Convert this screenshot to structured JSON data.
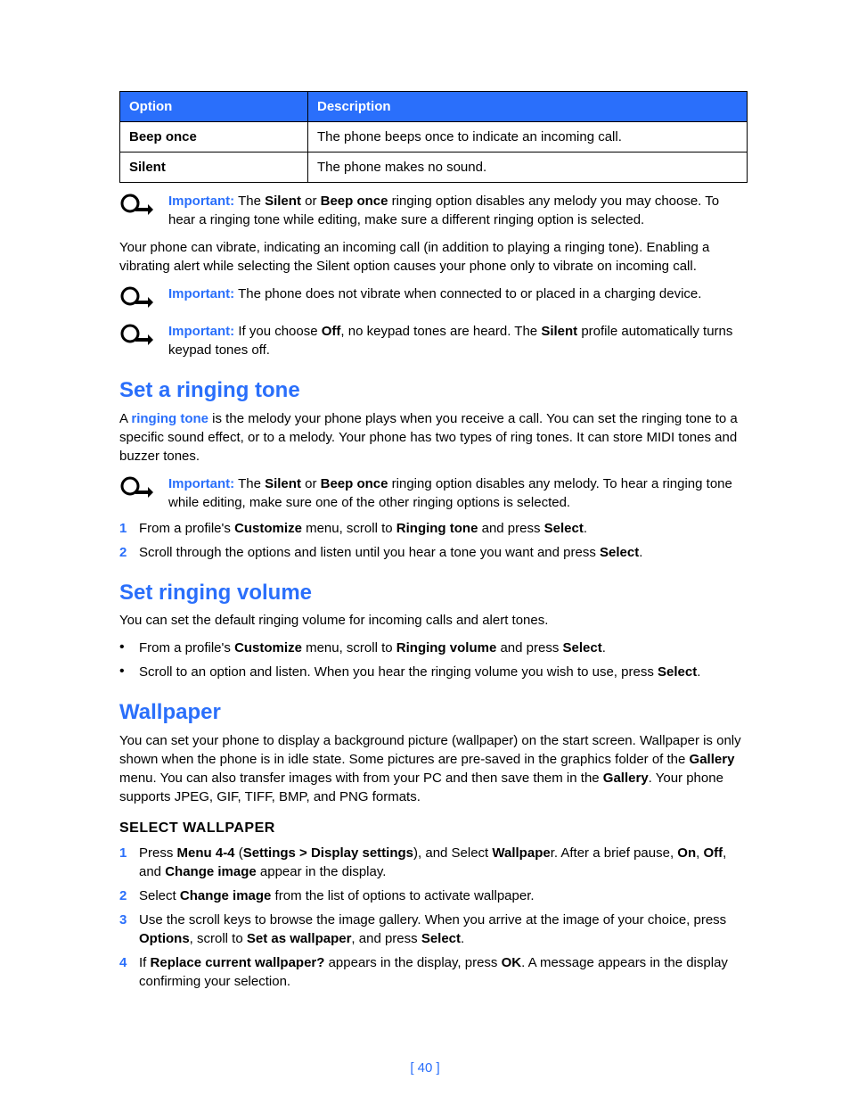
{
  "table": {
    "headers": [
      "Option",
      "Description"
    ],
    "rows": [
      {
        "option": "Beep once",
        "desc": "The phone beeps once to indicate an incoming call."
      },
      {
        "option": "Silent",
        "desc": "The phone makes no sound."
      }
    ]
  },
  "labels": {
    "important": "Important:"
  },
  "notes": {
    "n1_a": "The ",
    "n1_b": "Silent",
    "n1_c": " or ",
    "n1_d": "Beep once",
    "n1_e": " ringing option disables any melody you may choose. To hear a ringing tone while editing, make sure a different ringing option is selected.",
    "para1": "Your phone can vibrate, indicating an incoming call (in addition to playing a ringing tone). Enabling a vibrating alert while selecting the Silent option causes your phone only to vibrate on incoming call.",
    "n2": "The phone does not vibrate when connected to or placed in a charging device.",
    "n3_a": "If you choose ",
    "n3_b": "Off",
    "n3_c": ", no keypad tones are heard. The ",
    "n3_d": "Silent",
    "n3_e": " profile automatically turns keypad tones off."
  },
  "ringtone": {
    "heading": "Set a ringing tone",
    "intro_a": "A ",
    "intro_term": "ringing tone",
    "intro_b": " is the melody your phone plays when you receive a call. You can set the ringing tone to a specific sound effect, or to a melody. Your phone has two types of ring tones. It can store MIDI tones and buzzer tones.",
    "note_a": "The ",
    "note_b": "Silent",
    "note_c": " or ",
    "note_d": "Beep once",
    "note_e": " ringing option disables any melody. To hear a ringing tone while editing, make sure one of the other ringing options is selected.",
    "step1_a": "From a profile's ",
    "step1_b": "Customize",
    "step1_c": " menu, scroll to ",
    "step1_d": "Ringing tone",
    "step1_e": " and press ",
    "step1_f": "Select",
    "step1_g": ".",
    "step2_a": "Scroll through the options and listen until you hear a tone you want and press ",
    "step2_b": "Select",
    "step2_c": "."
  },
  "volume": {
    "heading": "Set ringing volume",
    "intro": "You can set the default ringing volume for incoming calls and alert tones.",
    "b1_a": "From a profile's ",
    "b1_b": "Customize",
    "b1_c": " menu, scroll to ",
    "b1_d": "Ringing volume",
    "b1_e": " and press ",
    "b1_f": "Select",
    "b1_g": ".",
    "b2_a": "Scroll to an option and listen. When you hear the ringing volume you wish to use, press ",
    "b2_b": "Select",
    "b2_c": "."
  },
  "wallpaper": {
    "heading": "Wallpaper",
    "intro_a": "You can set your phone to display a background picture (wallpaper) on the start screen. Wallpaper is only shown when the phone is in idle state. Some pictures are pre-saved in the graphics folder of the ",
    "intro_b": "Gallery",
    "intro_c": " menu. You can also transfer images with from your PC and then save them in the ",
    "intro_d": "Gallery",
    "intro_e": ". Your phone supports JPEG, GIF, TIFF, BMP, and PNG formats.",
    "sub": "SELECT WALLPAPER",
    "s1_a": "Press ",
    "s1_b": "Menu 4-4",
    "s1_c": " (",
    "s1_d": "Settings > Display settings",
    "s1_e": "), and Select ",
    "s1_f": "Wallpape",
    "s1_g": "r. After a brief pause, ",
    "s1_h": "On",
    "s1_i": ", ",
    "s1_j": "Off",
    "s1_k": ", and ",
    "s1_l": "Change image",
    "s1_m": " appear in the display.",
    "s2_a": "Select ",
    "s2_b": "Change image",
    "s2_c": " from the list of options to activate wallpaper.",
    "s3_a": "Use the scroll keys to browse the image gallery. When you arrive at the image of your choice, press ",
    "s3_b": "Options",
    "s3_c": ", scroll to ",
    "s3_d": "Set as wallpaper",
    "s3_e": ", and press ",
    "s3_f": "Select",
    "s3_g": ".",
    "s4_a": "If ",
    "s4_b": "Replace current wallpaper?",
    "s4_c": " appears in the display, press ",
    "s4_d": "OK",
    "s4_e": ". A message appears in the display confirming your selection."
  },
  "page_number": "[ 40 ]"
}
